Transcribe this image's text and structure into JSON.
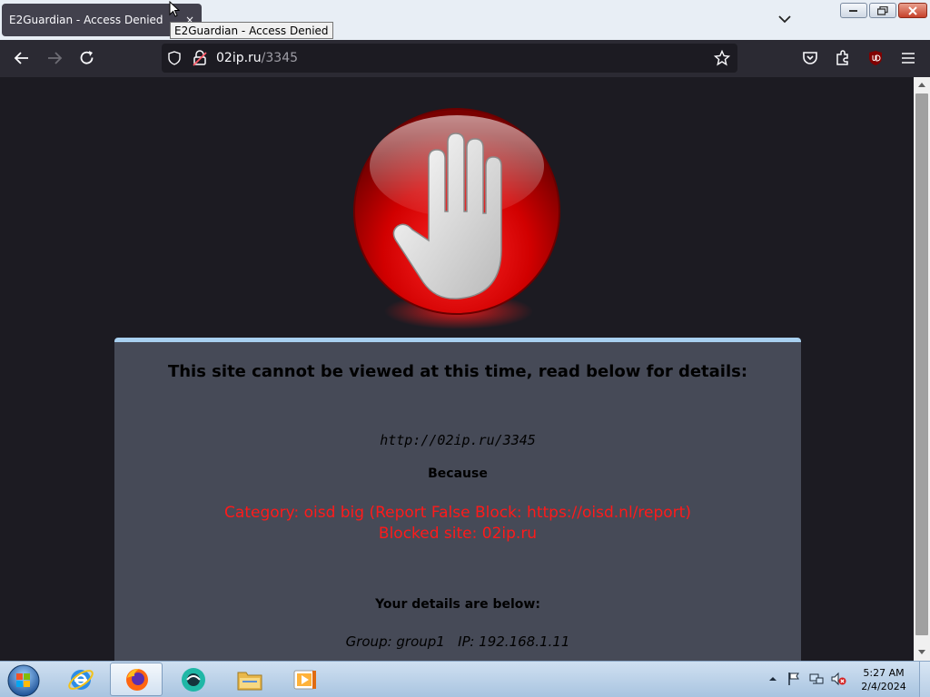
{
  "browser": {
    "tab": {
      "title": "E2Guardian - Access Denied",
      "close_glyph": "×"
    },
    "tooltip": "E2Guardian - Access Denied",
    "url": {
      "host": "02ip.ru",
      "path": "/3345"
    }
  },
  "page": {
    "title": "This site cannot be viewed at this time, read below for details:",
    "blocked_url": "http://02ip.ru/3345",
    "because_label": "Because",
    "reason_category": "Category: oisd big (Report False Block: https://oisd.nl/report)",
    "reason_site": "Blocked site: 02ip.ru",
    "details_label": "Your details are below:",
    "details_line": "Group: group1   IP: 192.168.1.11"
  },
  "taskbar": {
    "time": "5:27 AM",
    "date": "2/4/2024",
    "apps": [
      "internet-explorer",
      "firefox",
      "chat-app",
      "file-explorer",
      "media-player"
    ]
  },
  "colors": {
    "accent_red": "#ff1a1a",
    "panel_bg": "#464a57",
    "panel_border": "#a8d0f0",
    "page_bg": "#1c1b22"
  }
}
